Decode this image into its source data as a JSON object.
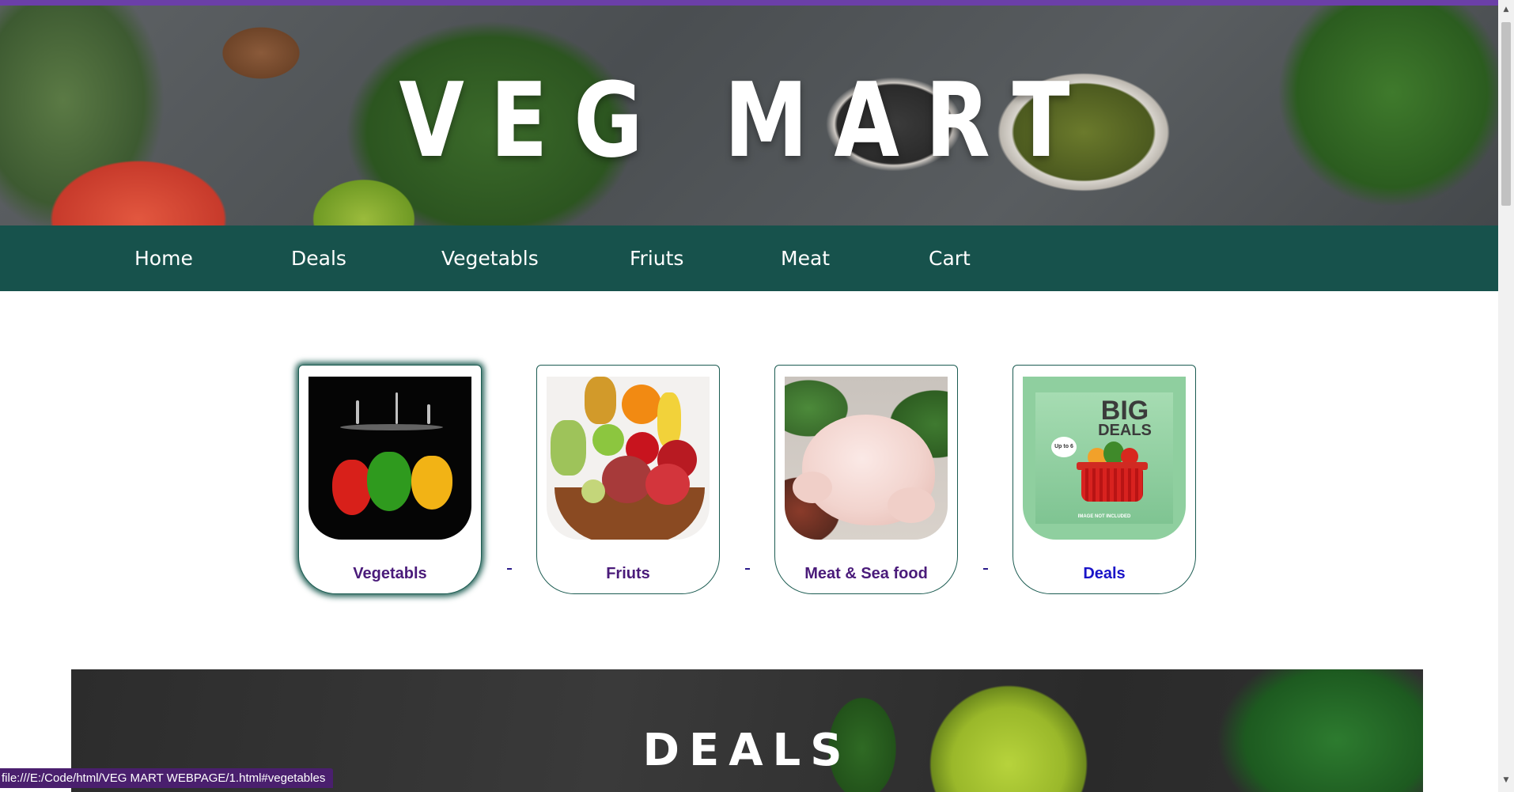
{
  "header": {
    "title": "VEG MART"
  },
  "nav": {
    "items": [
      {
        "label": "Home"
      },
      {
        "label": "Deals"
      },
      {
        "label": "Vegetabls"
      },
      {
        "label": "Friuts"
      },
      {
        "label": "Meat"
      },
      {
        "label": "Cart"
      }
    ]
  },
  "categories": [
    {
      "label": "Vegetabls"
    },
    {
      "label": "Friuts"
    },
    {
      "label": "Meat & Sea food"
    },
    {
      "label": "Deals"
    }
  ],
  "deals_image": {
    "big": "BIG",
    "deals": "DEALS",
    "bubble": "Up to 6",
    "fineprint": "IMAGE NOT INCLUDED"
  },
  "deals_section": {
    "title": "DEALS"
  },
  "status_bar": {
    "url": "file:///E:/Code/html/VEG MART WEBPAGE/1.html#vegetables"
  },
  "colors": {
    "accent_purple": "#6b3fa8",
    "nav_green": "#17524c",
    "card_border": "#1c5c52",
    "label_purple": "#4a1b7a",
    "label_blue": "#1a14c8"
  }
}
